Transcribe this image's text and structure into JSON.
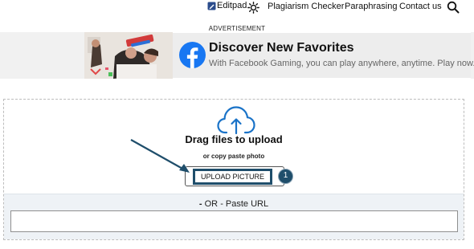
{
  "nav": {
    "brand": "Editpad",
    "links": [
      "Plagiarism Checker",
      "Paraphrasing",
      "Contact us"
    ],
    "icons": {
      "theme": "sun-icon",
      "search": "search-icon"
    }
  },
  "ad": {
    "label": "ADVERTISEMENT",
    "title": "Discover New Favorites",
    "subtitle": "With Facebook Gaming, you can play anywhere, anytime. Play now.",
    "brand_color": "#1877f2"
  },
  "upload": {
    "title": "Drag files to upload",
    "subtitle": "or copy paste photo",
    "button_label": "UPLOAD PICTURE",
    "step_number": "1",
    "accent_color": "#1f4e6b",
    "icon_color": "#1a73c8"
  },
  "url": {
    "dash": "-",
    "or_text": "OR",
    "label": "- Paste URL",
    "placeholder": ""
  }
}
